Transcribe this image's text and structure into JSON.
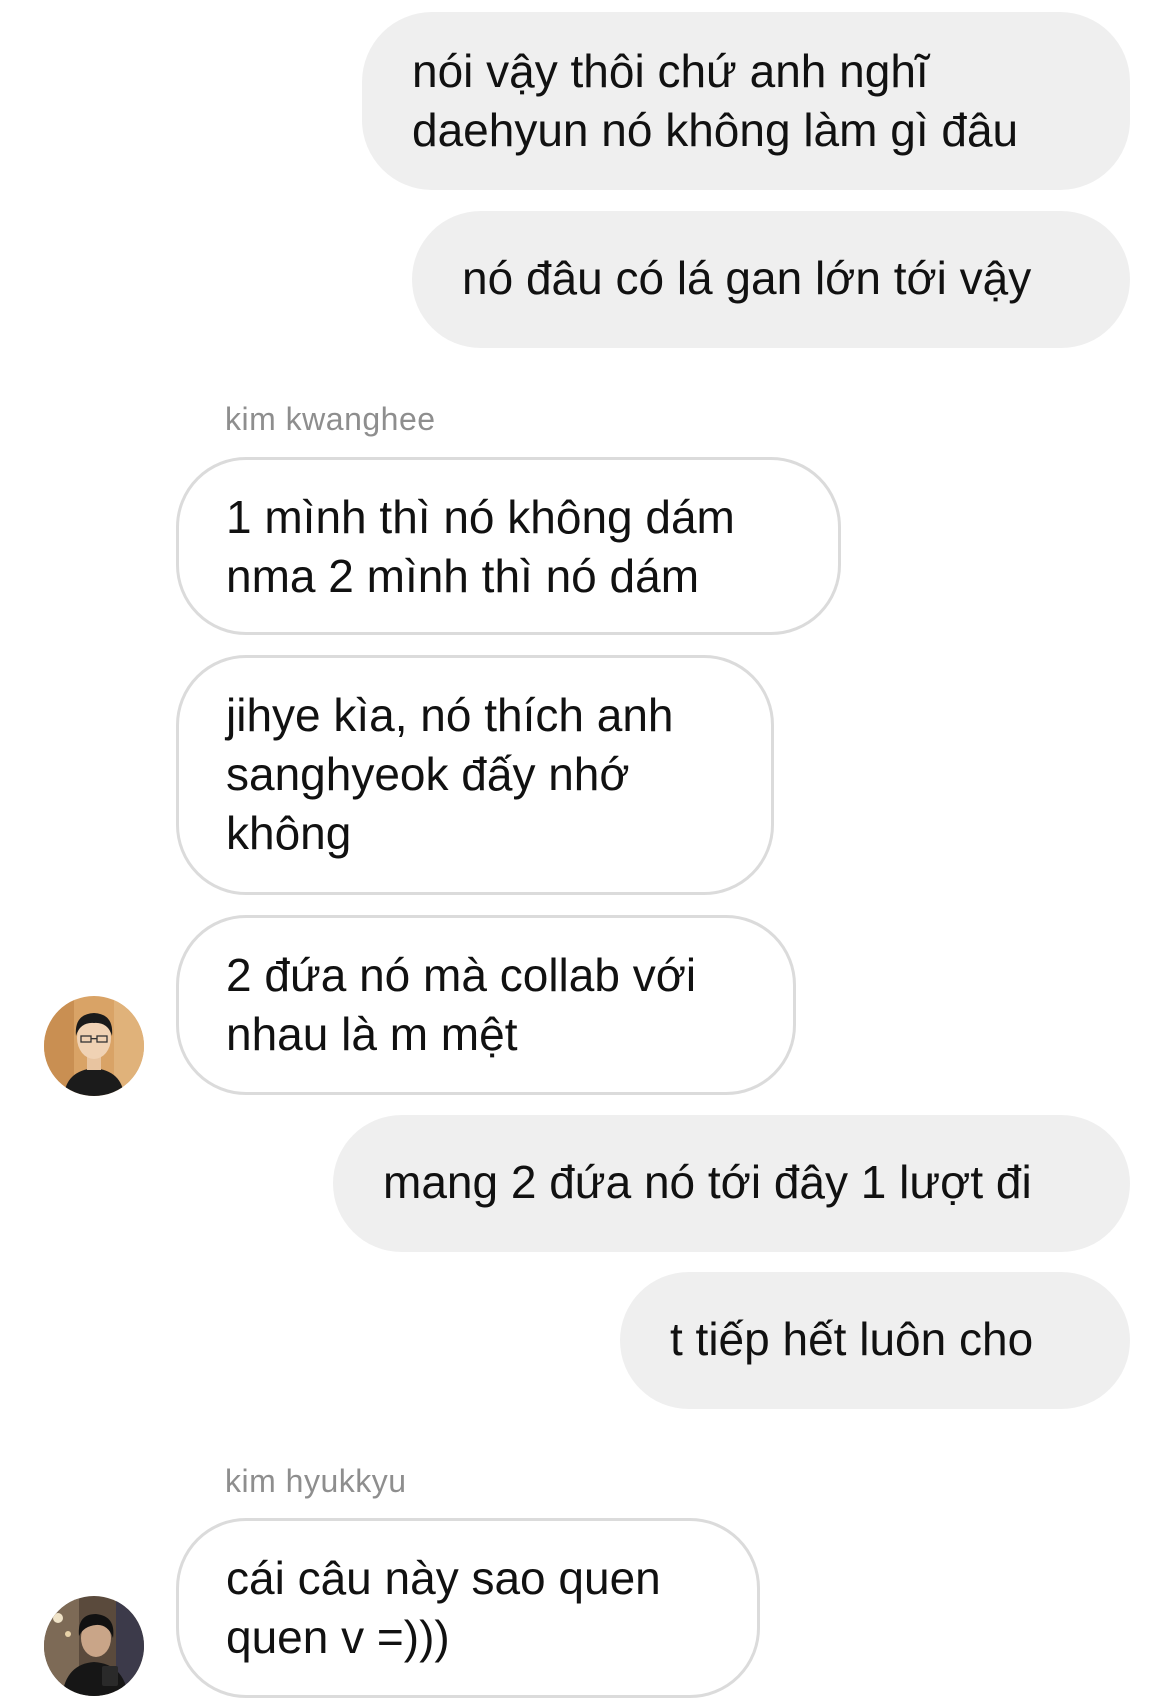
{
  "messages": [
    {
      "direction": "outgoing",
      "text": "nói vậy thôi chứ anh nghĩ\ndaehyun nó không làm gì đâu"
    },
    {
      "direction": "outgoing",
      "text": "nó đâu có lá gan lớn tới vậy"
    },
    {
      "direction": "incoming",
      "sender": "kim kwanghee",
      "text": "1 mình thì nó không dám\nnma 2 mình thì nó dám"
    },
    {
      "direction": "incoming",
      "text": "jihye kìa, nó thích anh\nsanghyeok đấy nhớ\nkhông"
    },
    {
      "direction": "incoming",
      "text": "2 đứa nó mà collab với\nnhau là m mệt"
    },
    {
      "direction": "outgoing",
      "text": "mang 2 đứa nó tới đây 1 lượt đi"
    },
    {
      "direction": "outgoing",
      "text": "t tiếp hết luôn cho"
    },
    {
      "direction": "incoming",
      "sender": "kim hyukkyu",
      "text": "cái câu này sao quen\nquen v =)))"
    }
  ],
  "colors": {
    "outgoing_bubble": "#efefef",
    "incoming_border": "#dbdbdb",
    "sender_name": "#8e8e8e",
    "text": "#111111"
  },
  "icons": {
    "avatar_kwanghee": "profile-photo-avatar",
    "avatar_hyukkyu": "profile-photo-avatar"
  }
}
